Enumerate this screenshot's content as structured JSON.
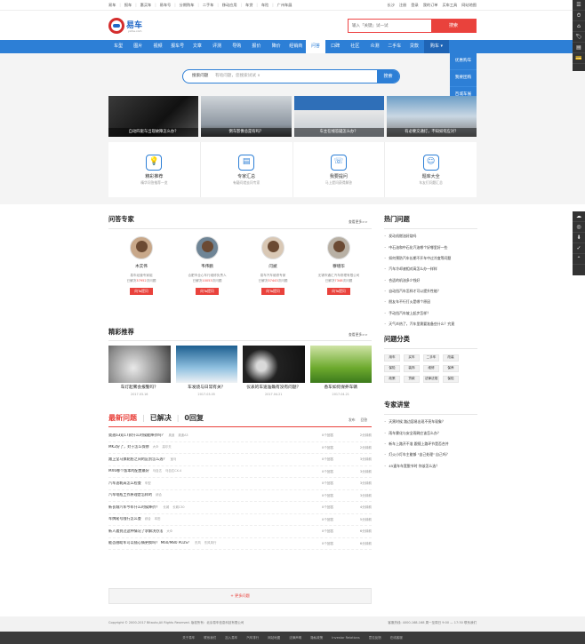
{
  "topbar": {
    "left": [
      "易车",
      "报车",
      "惠买车",
      "易车号",
      "分期购车",
      "二手车",
      "移动应用",
      "车贷",
      "车险",
      "广州车展"
    ],
    "right": [
      "长沙",
      "注册",
      "登录",
      "我的订单",
      "买车工具",
      "网站地图"
    ]
  },
  "header": {
    "logo_text": "易车",
    "logo_sub": "yiche.com",
    "search_placeholder": "输入「关键」试一试",
    "search_button": "搜索"
  },
  "nav": {
    "items": [
      "车型",
      "图片",
      "视频",
      "报车号",
      "文章",
      "评测",
      "导购",
      "报价",
      "降价",
      "经销商",
      "问答",
      "口碑",
      "社区",
      "众测",
      "二手车",
      "贷款",
      "购车 ▾"
    ],
    "active_index": 10,
    "dropdown": [
      "优惠购车",
      "我要团购",
      "百城车展",
      "限时抢购"
    ]
  },
  "qsearch": {
    "label": "搜索问题",
    "placeholder": "有啥问题，您搜索试试 ∨",
    "button": "搜索"
  },
  "banners": [
    {
      "caption": "自动四驱车出现故障怎么办？"
    },
    {
      "caption": "倒车影像总是有吗？"
    },
    {
      "caption": "车主在线答疑怎么办？"
    },
    {
      "caption": "有必要交通灯，不知如何应对？"
    }
  ],
  "features": [
    {
      "icon": "lightbulb-icon",
      "glyph": "💡",
      "title": "精彩推荐",
      "sub": "精华问答推荐一览"
    },
    {
      "icon": "book-icon",
      "glyph": "▤",
      "title": "专家汇总",
      "sub": "有疑问就去问专家"
    },
    {
      "icon": "phone-icon",
      "glyph": "☏",
      "title": "我要提问",
      "sub": "马上提问获得解答"
    },
    {
      "icon": "chat-icon",
      "glyph": "☺",
      "title": "题库大全",
      "sub": "车友们问题汇总"
    }
  ],
  "experts_section": {
    "title": "问答专家",
    "more": "查看更多>>",
    "experts": [
      {
        "name": "木实伟",
        "desc": "易车经营专家组",
        "answers_pre": "已解决",
        "answers": "37952",
        "answers_post": "次问题",
        "button": "向Ta提问"
      },
      {
        "name": "韦伟鹏",
        "desc": "合肥市全心车行维修负责人",
        "answers_pre": "已解决",
        "answers": "10053",
        "answers_post": "次问题",
        "button": "向Ta提问"
      },
      {
        "name": "闫斌",
        "desc": "易车汽车维修专家",
        "answers_pre": "已解决",
        "answers": "37443",
        "answers_post": "次问题",
        "button": "向Ta提问"
      },
      {
        "name": "穆增华",
        "desc": "无锡市通汇汽车修理有限公司",
        "answers_pre": "已解决",
        "answers": "7348",
        "answers_post": "次问题",
        "button": "向Ta提问"
      }
    ]
  },
  "recs_section": {
    "title": "精彩推荐",
    "more": "查看更多>>",
    "items": [
      {
        "title": "车灯起雾会报警吗？",
        "date": "2017.03.16"
      },
      {
        "title": "车发烧与日常有关？",
        "date": "2017.03.05"
      },
      {
        "title": "仪表的车速准确有没有问题？",
        "date": "2017.04.21"
      },
      {
        "title": "香车如何保养车辆",
        "date": "2017.04.21"
      }
    ]
  },
  "questions_section": {
    "tabs": [
      "最新问题",
      "已解决",
      "0回复"
    ],
    "right": [
      "发布",
      "回答"
    ],
    "rows": [
      {
        "q": "奥迪a3双17款什么时候能降价吗？",
        "t1": "奥迪",
        "t2": "奥迪A3",
        "c": "0个回答",
        "tm": "2分钟前"
      },
      {
        "q": "MK2好了，对于怎么保修",
        "t1": "大众",
        "t2": "高尔夫",
        "c": "0个回答",
        "tm": "2分钟前"
      },
      {
        "q": "路上宝马换轮胎之间的区别怎么选？",
        "t1": "宝马",
        "t2": "",
        "c": "0个回答",
        "tm": "3分钟前"
      },
      {
        "q": "MX6哪个版本的配置最好",
        "t1": "马自达",
        "t2": "马自达CX-4",
        "c": "0个回答",
        "tm": "3分钟前"
      },
      {
        "q": "汽车油耗高怎么检查",
        "t1": "车型",
        "t2": "",
        "c": "0个回答",
        "tm": "3分钟前"
      },
      {
        "q": "汽车电瓶工作原理是怎样的",
        "t1": "综合",
        "t2": "",
        "c": "0个回答",
        "tm": "3分钟前"
      },
      {
        "q": "新长城汽车今年什么时候降价？",
        "t1": "长城",
        "t2": "长城C30",
        "c": "0个回答",
        "tm": "4分钟前"
      },
      {
        "q": "车牌尾号限行怎么查",
        "t1": "综合",
        "t2": "本田",
        "c": "0个回答",
        "tm": "5分钟前"
      },
      {
        "q": "新人遇到过这种情况了求解决办法",
        "t1": "大众",
        "t2": "",
        "c": "0个回答",
        "tm": "6分钟前"
      },
      {
        "q": "能否借助车可以随心情更换吗？ M60/M80 PLUS？",
        "t1": "东风",
        "t2": "东风风行",
        "c": "0个回答",
        "tm": "6分钟前"
      }
    ],
    "load_more": "+ 更多问题"
  },
  "hot_section": {
    "title": "热门问题",
    "items": [
      "发动机燃油好烧吗",
      "中石油和中石化汽油哪个好哪里好一些",
      "如何预防汽车长期不开车中过冷度等问题",
      "汽车冷却液相对高怎么办一样样",
      "合适的机油多少钱好",
      "自动挡汽车怎样才可以提升性能？",
      "朋友车不行打火是哪个原因",
      "手动挡汽车坡上起步怎样？",
      "天气炎热了，汽车里需要准备些什么？究竟"
    ]
  },
  "category_section": {
    "title": "问题分类",
    "tags": [
      "用车",
      "买车",
      "二手车",
      "改装",
      "保险",
      "装饰",
      "维修",
      "保养",
      "政策",
      "贷款",
      "法律法规",
      "保险"
    ]
  },
  "expert_talk_section": {
    "title": "专家讲堂",
    "items": [
      "天黑时候 路边容易出现不亮车现象？",
      "雨车雾化与安全雨刷应该怎么办？",
      "新车上路开不准 跟随上路环节是否合并",
      "灯火小灯车主能够 \"自己处理\" 自己吗？",
      "45速车车宽脱节时 你该怎么选？"
    ]
  },
  "footer": {
    "copyright": "Copyright © 2000-2017 Bitauto,All Rights Reserved.   版权所有：北京易车信息科技有限公司",
    "contact": "客服热线: 4000-168-168   周一至周日 9:00 — 17:30   联系我们",
    "links": [
      "关于易车",
      "联系我们",
      "加入易车",
      "汽车排行",
      "网站地图",
      "法律声明",
      "隐私政策",
      "Investor Relations",
      "意见反馈",
      "在线客服"
    ]
  },
  "side": {
    "top": [
      "☰",
      "⏱",
      "⌂",
      "🏷",
      "▤",
      "💳"
    ],
    "mid": [
      "☁",
      "◎",
      "⬇",
      "✓",
      "⌃"
    ]
  }
}
